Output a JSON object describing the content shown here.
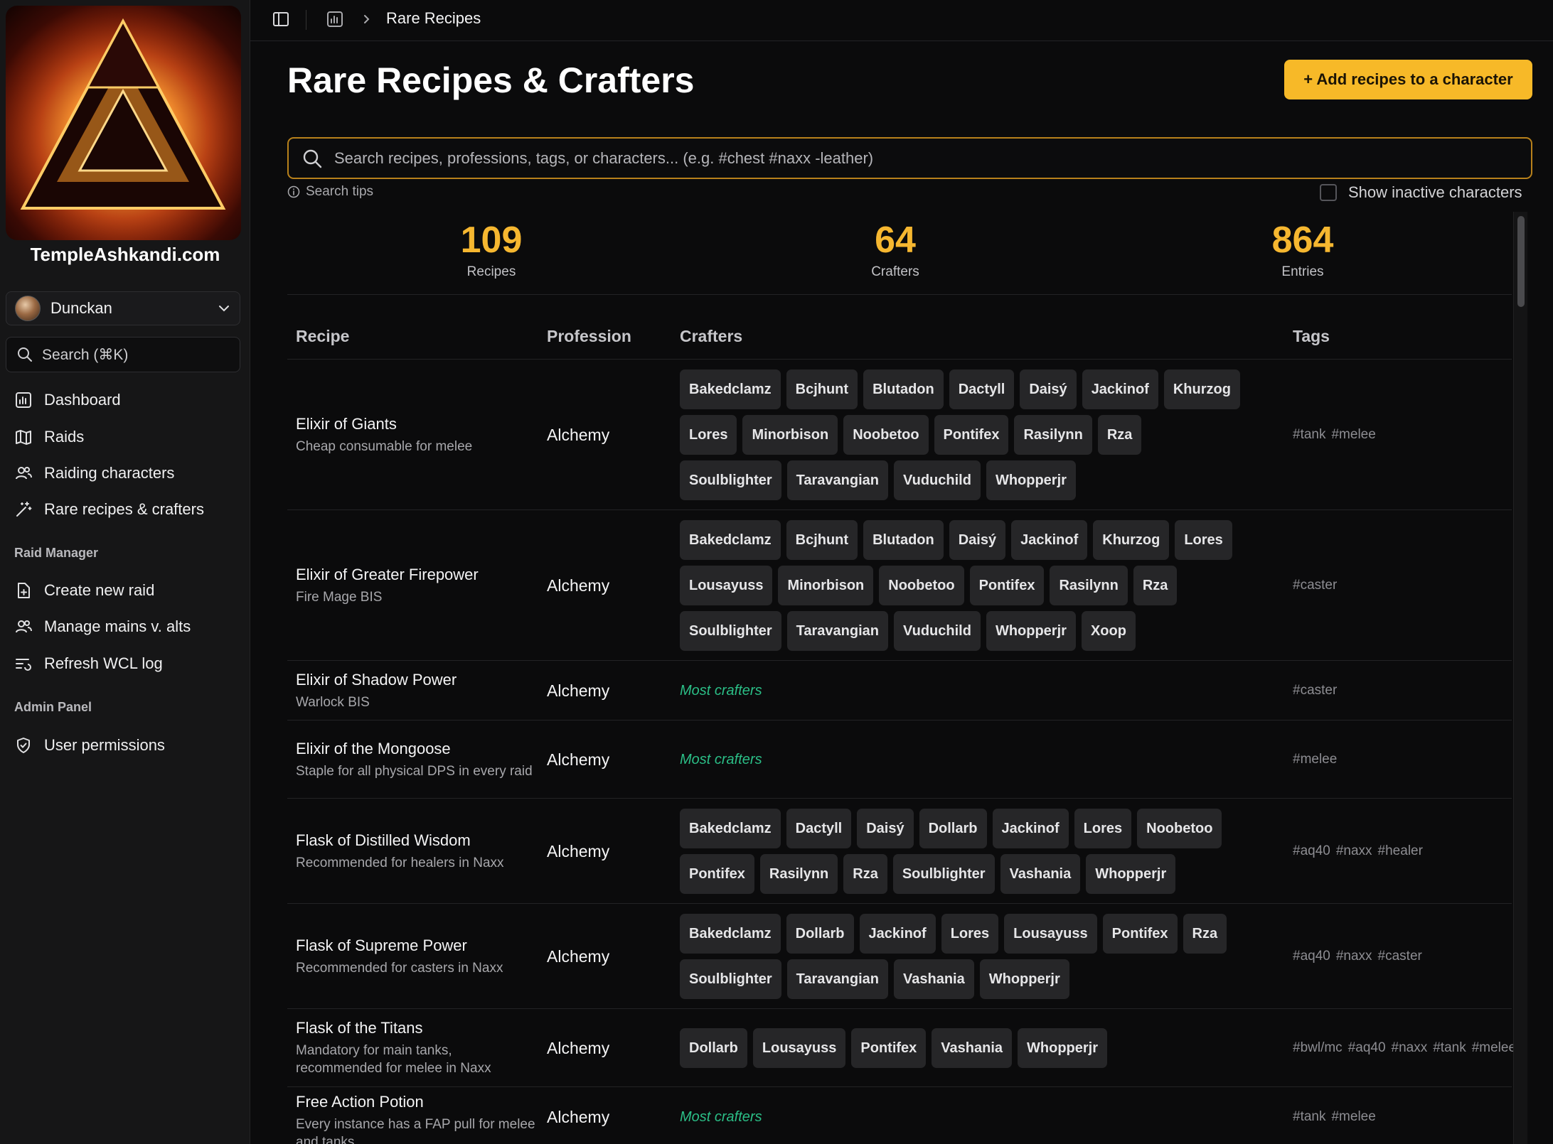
{
  "site": {
    "name": "TempleAshkandi.com"
  },
  "user": {
    "name": "Dunckan"
  },
  "sidebar": {
    "search_label": "Search (⌘K)",
    "nav": [
      {
        "label": "Dashboard",
        "icon": "dashboard-icon"
      },
      {
        "label": "Raids",
        "icon": "map-icon"
      },
      {
        "label": "Raiding characters",
        "icon": "users-icon"
      },
      {
        "label": "Rare recipes & crafters",
        "icon": "wand-icon"
      }
    ],
    "raid_manager": {
      "heading": "Raid Manager",
      "items": [
        {
          "label": "Create new raid",
          "icon": "file-plus-icon"
        },
        {
          "label": "Manage mains v. alts",
          "icon": "users-icon"
        },
        {
          "label": "Refresh WCL log",
          "icon": "list-refresh-icon"
        }
      ]
    },
    "admin": {
      "heading": "Admin Panel",
      "items": [
        {
          "label": "User permissions",
          "icon": "shield-icon"
        }
      ]
    }
  },
  "topbar": {
    "breadcrumb": "Rare Recipes"
  },
  "page": {
    "title": "Rare Recipes & Crafters",
    "add_button": "+ Add recipes to a character",
    "search_placeholder": "Search recipes, professions, tags, or characters... (e.g. #chest #naxx -leather)",
    "search_tips": "Search tips",
    "inactive_toggle": "Show inactive characters"
  },
  "stats": [
    {
      "value": "109",
      "label": "Recipes"
    },
    {
      "value": "64",
      "label": "Crafters"
    },
    {
      "value": "864",
      "label": "Entries"
    }
  ],
  "table": {
    "columns": {
      "recipe": "Recipe",
      "profession": "Profession",
      "crafters": "Crafters",
      "tags": "Tags"
    },
    "most_crafters_label": "Most crafters",
    "rows": [
      {
        "name": "Elixir of Giants",
        "desc": "Cheap consumable for melee",
        "profession": "Alchemy",
        "crafters": [
          "Bakedclamz",
          "Bcjhunt",
          "Blutadon",
          "Dactyll",
          "Daisý",
          "Jackinof",
          "Khurzog",
          "Lores",
          "Minorbison",
          "Noobetoo",
          "Pontifex",
          "Rasilynn",
          "Rza",
          "Soulblighter",
          "Taravangian",
          "Vuduchild",
          "Whopperjr"
        ],
        "tags": [
          "#tank",
          "#melee"
        ]
      },
      {
        "name": "Elixir of Greater Firepower",
        "desc": "Fire Mage BIS",
        "profession": "Alchemy",
        "crafters": [
          "Bakedclamz",
          "Bcjhunt",
          "Blutadon",
          "Daisý",
          "Jackinof",
          "Khurzog",
          "Lores",
          "Lousayuss",
          "Minorbison",
          "Noobetoo",
          "Pontifex",
          "Rasilynn",
          "Rza",
          "Soulblighter",
          "Taravangian",
          "Vuduchild",
          "Whopperjr",
          "Xoop"
        ],
        "tags": [
          "#caster"
        ]
      },
      {
        "name": "Elixir of Shadow Power",
        "desc": "Warlock BIS",
        "profession": "Alchemy",
        "crafters": [],
        "most": true,
        "tags": [
          "#caster"
        ]
      },
      {
        "name": "Elixir of the Mongoose",
        "desc": "Staple for all physical DPS in every raid",
        "profession": "Alchemy",
        "crafters": [],
        "most": true,
        "tags": [
          "#melee"
        ]
      },
      {
        "name": "Flask of Distilled Wisdom",
        "desc": "Recommended for healers in Naxx",
        "profession": "Alchemy",
        "crafters": [
          "Bakedclamz",
          "Dactyll",
          "Daisý",
          "Dollarb",
          "Jackinof",
          "Lores",
          "Noobetoo",
          "Pontifex",
          "Rasilynn",
          "Rza",
          "Soulblighter",
          "Vashania",
          "Whopperjr"
        ],
        "tags": [
          "#aq40",
          "#naxx",
          "#healer"
        ]
      },
      {
        "name": "Flask of Supreme Power",
        "desc": "Recommended for casters in Naxx",
        "profession": "Alchemy",
        "crafters": [
          "Bakedclamz",
          "Dollarb",
          "Jackinof",
          "Lores",
          "Lousayuss",
          "Pontifex",
          "Rza",
          "Soulblighter",
          "Taravangian",
          "Vashania",
          "Whopperjr"
        ],
        "tags": [
          "#aq40",
          "#naxx",
          "#caster"
        ]
      },
      {
        "name": "Flask of the Titans",
        "desc": "Mandatory for main tanks, recommended for melee in Naxx",
        "profession": "Alchemy",
        "crafters": [
          "Dollarb",
          "Lousayuss",
          "Pontifex",
          "Vashania",
          "Whopperjr"
        ],
        "tags": [
          "#bwl/mc",
          "#aq40",
          "#naxx",
          "#tank",
          "#melee"
        ]
      },
      {
        "name": "Free Action Potion",
        "desc": "Every instance has a FAP pull for melee and tanks",
        "profession": "Alchemy",
        "crafters": [],
        "most": true,
        "tags": [
          "#tank",
          "#melee"
        ]
      }
    ]
  }
}
